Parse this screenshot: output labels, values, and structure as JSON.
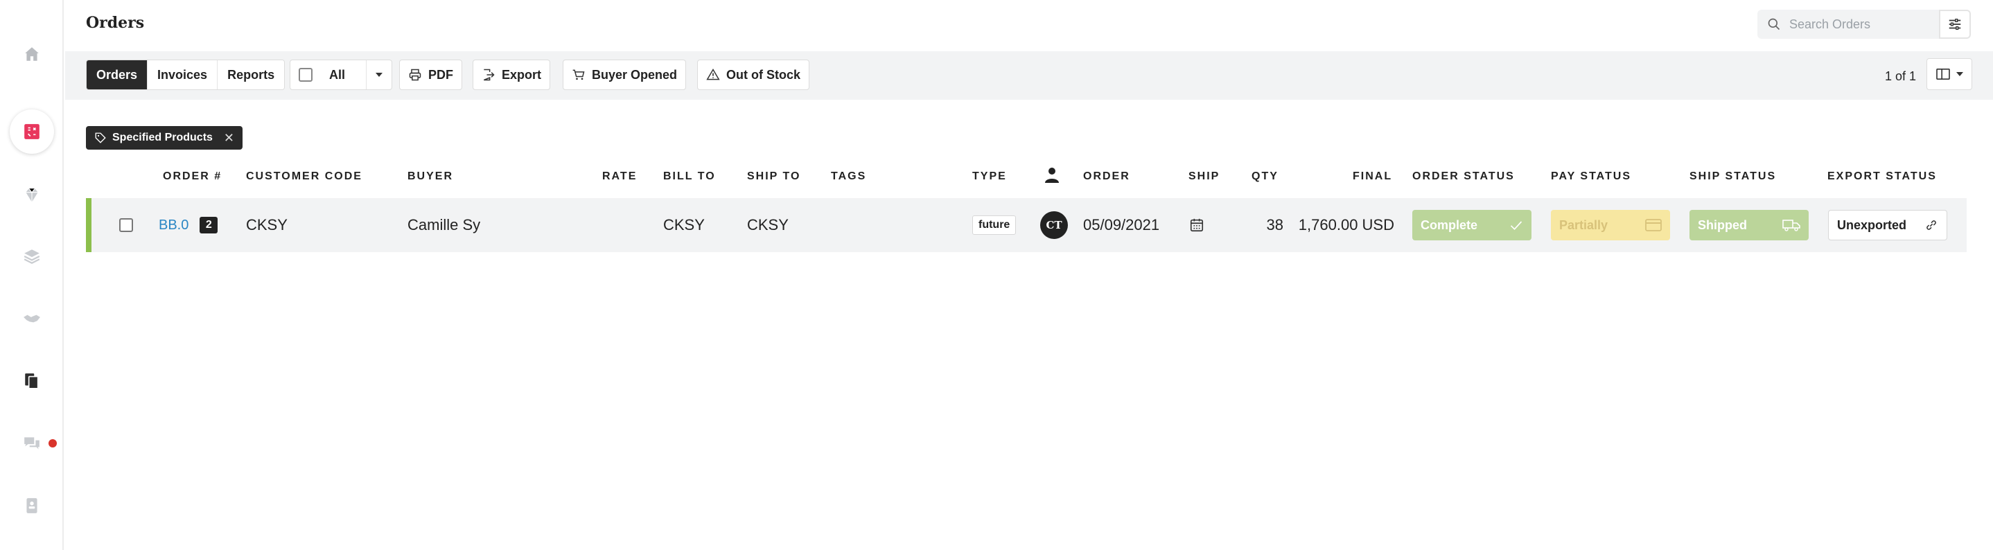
{
  "header": {
    "title": "Orders",
    "search_placeholder": "Search Orders"
  },
  "sidebar": {
    "items": [
      {
        "icon": "home-icon"
      },
      {
        "icon": "orders-icon",
        "active": true
      },
      {
        "icon": "gem-icon"
      },
      {
        "icon": "layers-icon"
      },
      {
        "icon": "handshake-icon"
      },
      {
        "icon": "documents-icon"
      },
      {
        "icon": "chat-icon",
        "notification": true
      },
      {
        "icon": "contact-card-icon"
      }
    ]
  },
  "toolbar": {
    "tabs": [
      "Orders",
      "Invoices",
      "Reports"
    ],
    "active_tab": "Orders",
    "all_label": "All",
    "pdf_label": "PDF",
    "export_label": "Export",
    "buyer_opened_label": "Buyer Opened",
    "out_of_stock_label": "Out of Stock",
    "pager": "1 of 1"
  },
  "filter_chip": {
    "label": "Specified Products"
  },
  "table": {
    "columns": {
      "order_no": "ORDER #",
      "customer_code": "CUSTOMER CODE",
      "buyer": "BUYER",
      "rate": "RATE",
      "bill_to": "BILL TO",
      "ship_to": "SHIP TO",
      "tags": "TAGS",
      "type": "TYPE",
      "order": "ORDER",
      "ship": "SHIP",
      "qty": "QTY",
      "final": "FINAL",
      "order_status": "ORDER STATUS",
      "pay_status": "PAY STATUS",
      "ship_status": "SHIP STATUS",
      "export_status": "EXPORT STATUS"
    },
    "rows": [
      {
        "order_no": "BB.0",
        "count": "2",
        "customer_code": "CKSY",
        "buyer": "Camille Sy",
        "rate": "",
        "bill_to": "CKSY",
        "ship_to": "CKSY",
        "tags": "",
        "type": "future",
        "rep_initials": "CT",
        "order_date": "05/09/2021",
        "qty": "38",
        "final": "1,760.00 USD",
        "order_status": "Complete",
        "pay_status": "Partially",
        "ship_status": "Shipped",
        "export_status": "Unexported"
      }
    ]
  },
  "colors": {
    "row_accent": "#8cbf4c",
    "link": "#2a86c4",
    "complete": "#bbd59a",
    "partial": "#f7e7a1",
    "brand": "#e8365d"
  }
}
